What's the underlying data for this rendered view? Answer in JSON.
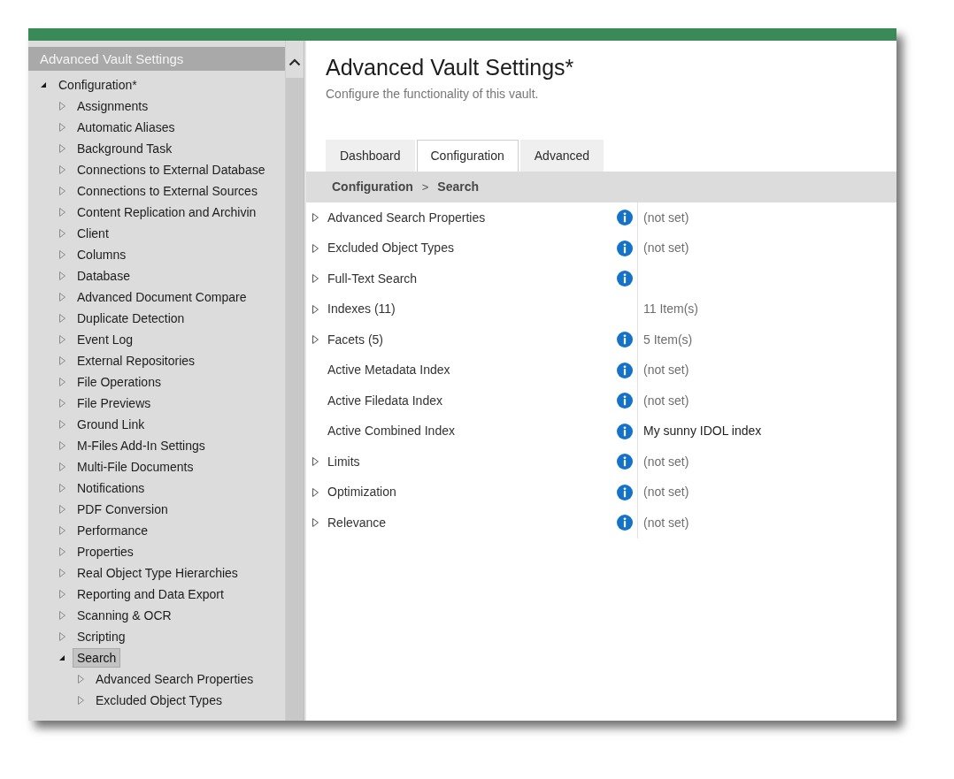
{
  "sidebar": {
    "header": "Advanced Vault Settings",
    "tree": [
      {
        "label": "Configuration*",
        "expanded": true,
        "selected": false,
        "children": [
          {
            "label": "Assignments",
            "expanded": false,
            "selected": false
          },
          {
            "label": "Automatic Aliases",
            "expanded": false,
            "selected": false
          },
          {
            "label": "Background Task",
            "expanded": false,
            "selected": false
          },
          {
            "label": "Connections to External Database",
            "expanded": false,
            "selected": false
          },
          {
            "label": "Connections to External Sources",
            "expanded": false,
            "selected": false
          },
          {
            "label": "Content Replication and Archivin",
            "expanded": false,
            "selected": false
          },
          {
            "label": "Client",
            "expanded": false,
            "selected": false
          },
          {
            "label": "Columns",
            "expanded": false,
            "selected": false
          },
          {
            "label": "Database",
            "expanded": false,
            "selected": false
          },
          {
            "label": "Advanced Document Compare",
            "expanded": false,
            "selected": false
          },
          {
            "label": "Duplicate Detection",
            "expanded": false,
            "selected": false
          },
          {
            "label": "Event Log",
            "expanded": false,
            "selected": false
          },
          {
            "label": "External Repositories",
            "expanded": false,
            "selected": false
          },
          {
            "label": "File Operations",
            "expanded": false,
            "selected": false
          },
          {
            "label": "File Previews",
            "expanded": false,
            "selected": false
          },
          {
            "label": "Ground Link",
            "expanded": false,
            "selected": false
          },
          {
            "label": "M-Files Add-In Settings",
            "expanded": false,
            "selected": false
          },
          {
            "label": "Multi-File Documents",
            "expanded": false,
            "selected": false
          },
          {
            "label": "Notifications",
            "expanded": false,
            "selected": false
          },
          {
            "label": "PDF Conversion",
            "expanded": false,
            "selected": false
          },
          {
            "label": "Performance",
            "expanded": false,
            "selected": false
          },
          {
            "label": "Properties",
            "expanded": false,
            "selected": false
          },
          {
            "label": "Real Object Type Hierarchies",
            "expanded": false,
            "selected": false
          },
          {
            "label": "Reporting and Data Export",
            "expanded": false,
            "selected": false
          },
          {
            "label": "Scanning & OCR",
            "expanded": false,
            "selected": false
          },
          {
            "label": "Scripting",
            "expanded": false,
            "selected": false
          },
          {
            "label": "Search",
            "expanded": true,
            "selected": true,
            "children": [
              {
                "label": "Advanced Search Properties",
                "expanded": false,
                "selected": false
              },
              {
                "label": "Excluded Object Types",
                "expanded": false,
                "selected": false
              }
            ]
          }
        ]
      }
    ]
  },
  "main": {
    "title": "Advanced Vault Settings*",
    "subtitle": "Configure the functionality of this vault.",
    "tabs": [
      {
        "label": "Dashboard",
        "selected": false
      },
      {
        "label": "Configuration",
        "selected": true
      },
      {
        "label": "Advanced",
        "selected": false
      }
    ],
    "breadcrumb": {
      "items": [
        "Configuration",
        "Search"
      ],
      "separator": ">"
    },
    "properties": [
      {
        "name": "Advanced Search Properties",
        "expandable": true,
        "info": true,
        "value": "(not set)",
        "default": true
      },
      {
        "name": "Excluded Object Types",
        "expandable": true,
        "info": true,
        "value": "(not set)",
        "default": true
      },
      {
        "name": "Full-Text Search",
        "expandable": true,
        "info": true
      },
      {
        "name": "Indexes (11)",
        "expandable": true,
        "info": false,
        "value": "11 Item(s)",
        "default": true
      },
      {
        "name": "Facets (5)",
        "expandable": true,
        "info": true,
        "value": "5 Item(s)",
        "default": true
      },
      {
        "name": "Active Metadata Index",
        "expandable": false,
        "info": true,
        "value": "(not set)",
        "default": true
      },
      {
        "name": "Active Filedata Index",
        "expandable": false,
        "info": true,
        "value": "(not set)",
        "default": true
      },
      {
        "name": "Active Combined Index",
        "expandable": false,
        "info": true,
        "value": "My sunny IDOL index",
        "default": false
      },
      {
        "name": "Limits",
        "expandable": true,
        "info": true,
        "value": "(not set)",
        "default": true
      },
      {
        "name": "Optimization",
        "expandable": true,
        "info": true,
        "value": "(not set)",
        "default": true
      },
      {
        "name": "Relevance",
        "expandable": true,
        "info": true,
        "value": "(not set)",
        "default": true
      }
    ]
  }
}
